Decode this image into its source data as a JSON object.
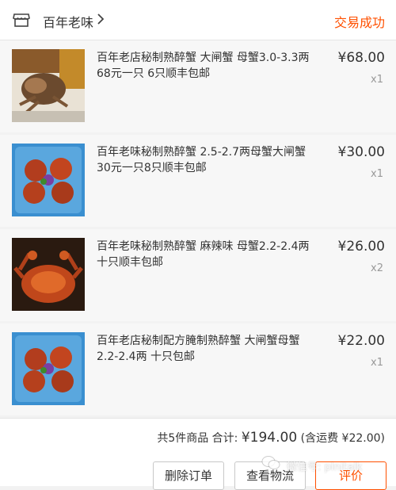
{
  "header": {
    "shop_name": "百年老味",
    "status": "交易成功"
  },
  "items": [
    {
      "title": "百年老店秘制熟醉蟹 大闸蟹 母蟹3.0-3.3两 68元一只 6只顺丰包邮",
      "price": "¥68.00",
      "qty": "x1"
    },
    {
      "title": "百年老味秘制熟醉蟹 2.5-2.7两母蟹大闸蟹 30元一只8只顺丰包邮",
      "price": "¥30.00",
      "qty": "x1"
    },
    {
      "title": "百年老味秘制熟醉蟹 麻辣味 母蟹2.2-2.4两 十只顺丰包邮",
      "price": "¥26.00",
      "qty": "x2"
    },
    {
      "title": "百年老店秘制配方腌制熟醉蟹 大闸蟹母蟹 2.2-2.4两 十只包邮",
      "price": "¥22.00",
      "qty": "x1"
    }
  ],
  "summary": {
    "count_label": "共5件商品 合计:",
    "total": "¥194.00",
    "shipping": "(含运费 ¥22.00)"
  },
  "actions": {
    "delete": "删除订单",
    "logistics": "查看物流",
    "review": "评价"
  },
  "watermark": "微信号: plnitalk",
  "colors": {
    "accent": "#ff5000",
    "text": "#333333",
    "muted": "#999999",
    "item_bg": "#f7f7f7"
  }
}
